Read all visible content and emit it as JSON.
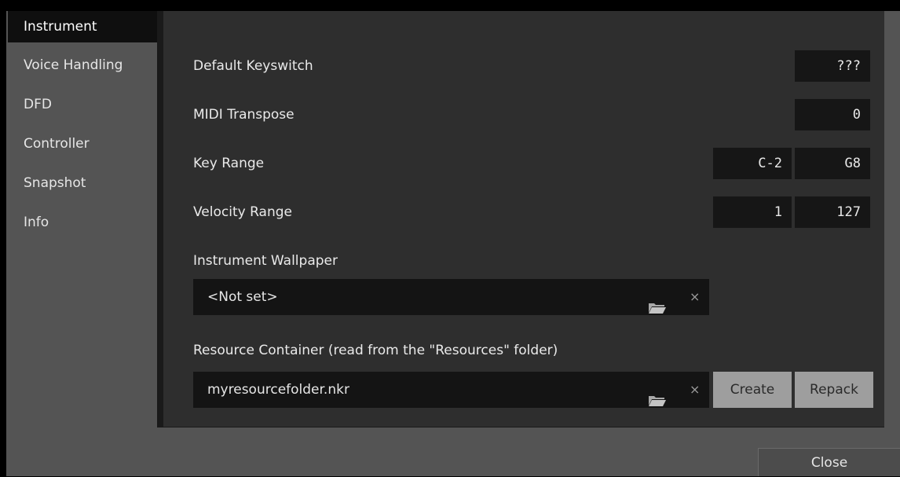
{
  "sidebar": {
    "items": [
      {
        "label": "Instrument",
        "active": true
      },
      {
        "label": "Voice Handling",
        "active": false
      },
      {
        "label": "DFD",
        "active": false
      },
      {
        "label": "Controller",
        "active": false
      },
      {
        "label": "Snapshot",
        "active": false
      },
      {
        "label": "Info",
        "active": false
      }
    ]
  },
  "settings": {
    "default_keyswitch": {
      "label": "Default Keyswitch",
      "value": "???"
    },
    "midi_transpose": {
      "label": "MIDI Transpose",
      "value": "0"
    },
    "key_range": {
      "label": "Key Range",
      "low": "C-2",
      "high": "G8"
    },
    "velocity_range": {
      "label": "Velocity Range",
      "low": "1",
      "high": "127"
    },
    "wallpaper": {
      "label": "Instrument Wallpaper",
      "value": "<Not set>",
      "clear": "×"
    },
    "resource_container": {
      "label": "Resource Container (read from the \"Resources\" folder)",
      "value": "myresourcefolder.nkr",
      "clear": "×",
      "create_label": "Create",
      "repack_label": "Repack"
    }
  },
  "footer": {
    "close_label": "Close"
  },
  "icons": {
    "folder": "folder-open-icon",
    "clear": "close-icon"
  },
  "colors": {
    "panel": "#2e2e2e",
    "field": "#141414",
    "button": "#9e9e9e",
    "window": "#545454"
  }
}
